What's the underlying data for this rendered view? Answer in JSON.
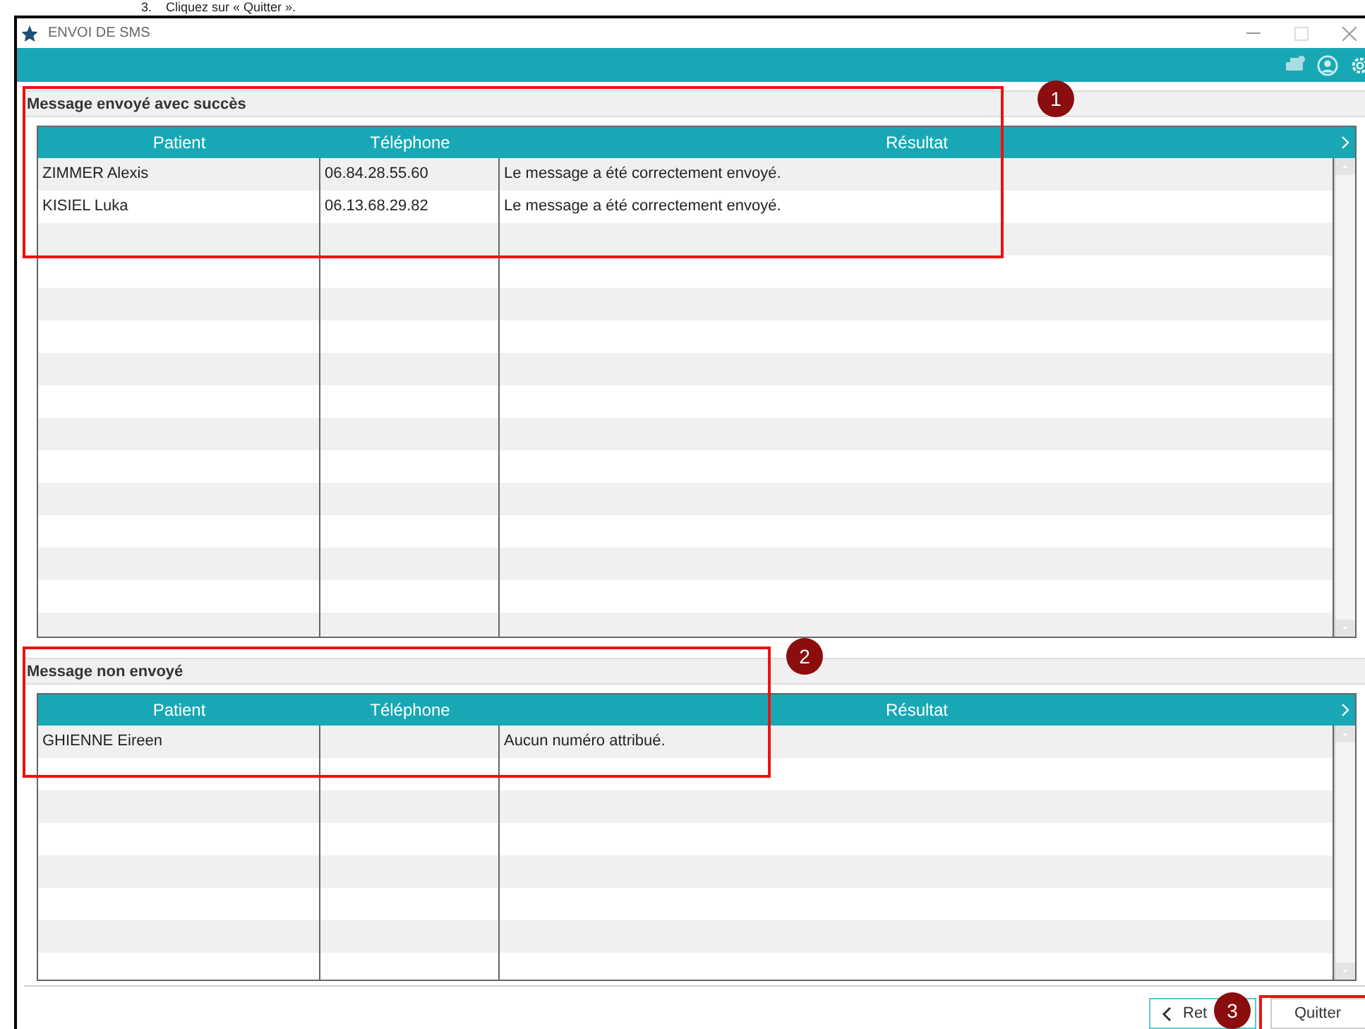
{
  "instruction": "3.    Cliquez sur « Quitter ».",
  "window": {
    "title": "ENVOI DE SMS"
  },
  "sections": [
    {
      "title": "Message envoyé avec succès",
      "columns": [
        "Patient",
        "Téléphone",
        "Résultat"
      ],
      "rows": [
        {
          "patient": "ZIMMER Alexis",
          "phone": "06.84.28.55.60",
          "result": "Le message a été correctement envoyé."
        },
        {
          "patient": "KISIEL Luka",
          "phone": "06.13.68.29.82",
          "result": "Le message a été correctement envoyé."
        }
      ]
    },
    {
      "title": "Message non envoyé",
      "columns": [
        "Patient",
        "Téléphone",
        "Résultat"
      ],
      "rows": [
        {
          "patient": "GHIENNE Eireen",
          "phone": "",
          "result": "Aucun numéro attribué."
        }
      ]
    }
  ],
  "buttons": [
    {
      "label": "Ret",
      "kind": "back"
    },
    {
      "label": "Quitter",
      "kind": "plain"
    }
  ],
  "annotations": [
    {
      "label": "1"
    },
    {
      "label": "2"
    },
    {
      "label": "3"
    }
  ]
}
